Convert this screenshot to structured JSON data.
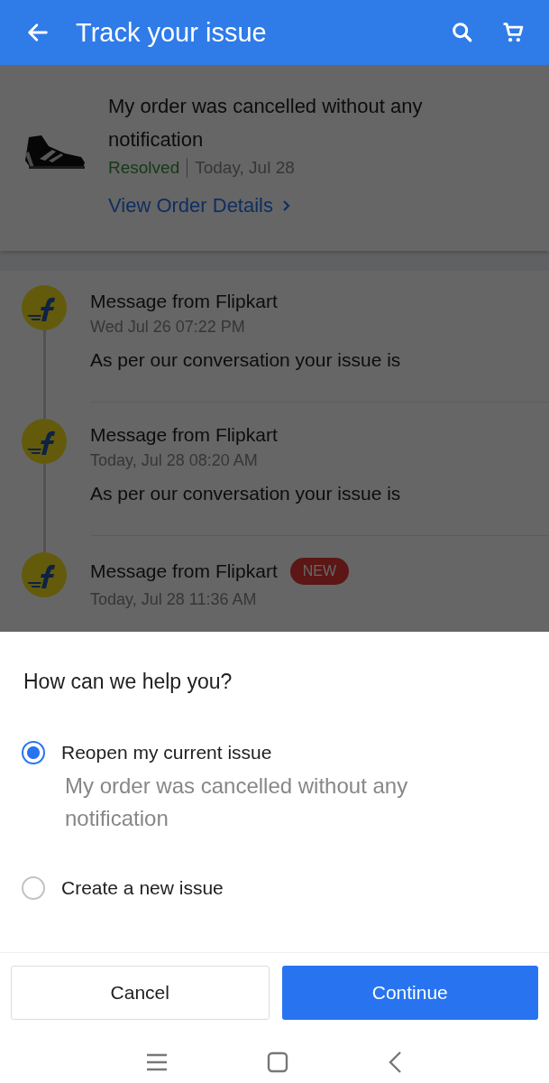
{
  "header": {
    "title": "Track your issue"
  },
  "issue": {
    "title": "My order was cancelled without any notification",
    "status": "Resolved",
    "date": "Today, Jul 28",
    "link": "View Order Details"
  },
  "messages": [
    {
      "title": "Message from Flipkart",
      "time": "Wed Jul 26 07:22 PM",
      "body": "As per our conversation your issue is"
    },
    {
      "title": "Message from Flipkart",
      "time": "Today, Jul 28 08:20 AM",
      "body": "As per our conversation your issue is"
    },
    {
      "title": "Message from Flipkart",
      "time": "Today, Jul 28 11:36 AM",
      "badge": "NEW"
    }
  ],
  "sheet": {
    "title": "How can we help you?",
    "options": [
      {
        "label": "Reopen my current issue",
        "selected": true,
        "detail": "My order was cancelled without any notification"
      },
      {
        "label": "Create a new issue",
        "selected": false
      }
    ],
    "buttons": [
      {
        "label": "Cancel",
        "kind": "secondary"
      },
      {
        "label": "Continue",
        "kind": "primary"
      }
    ]
  }
}
